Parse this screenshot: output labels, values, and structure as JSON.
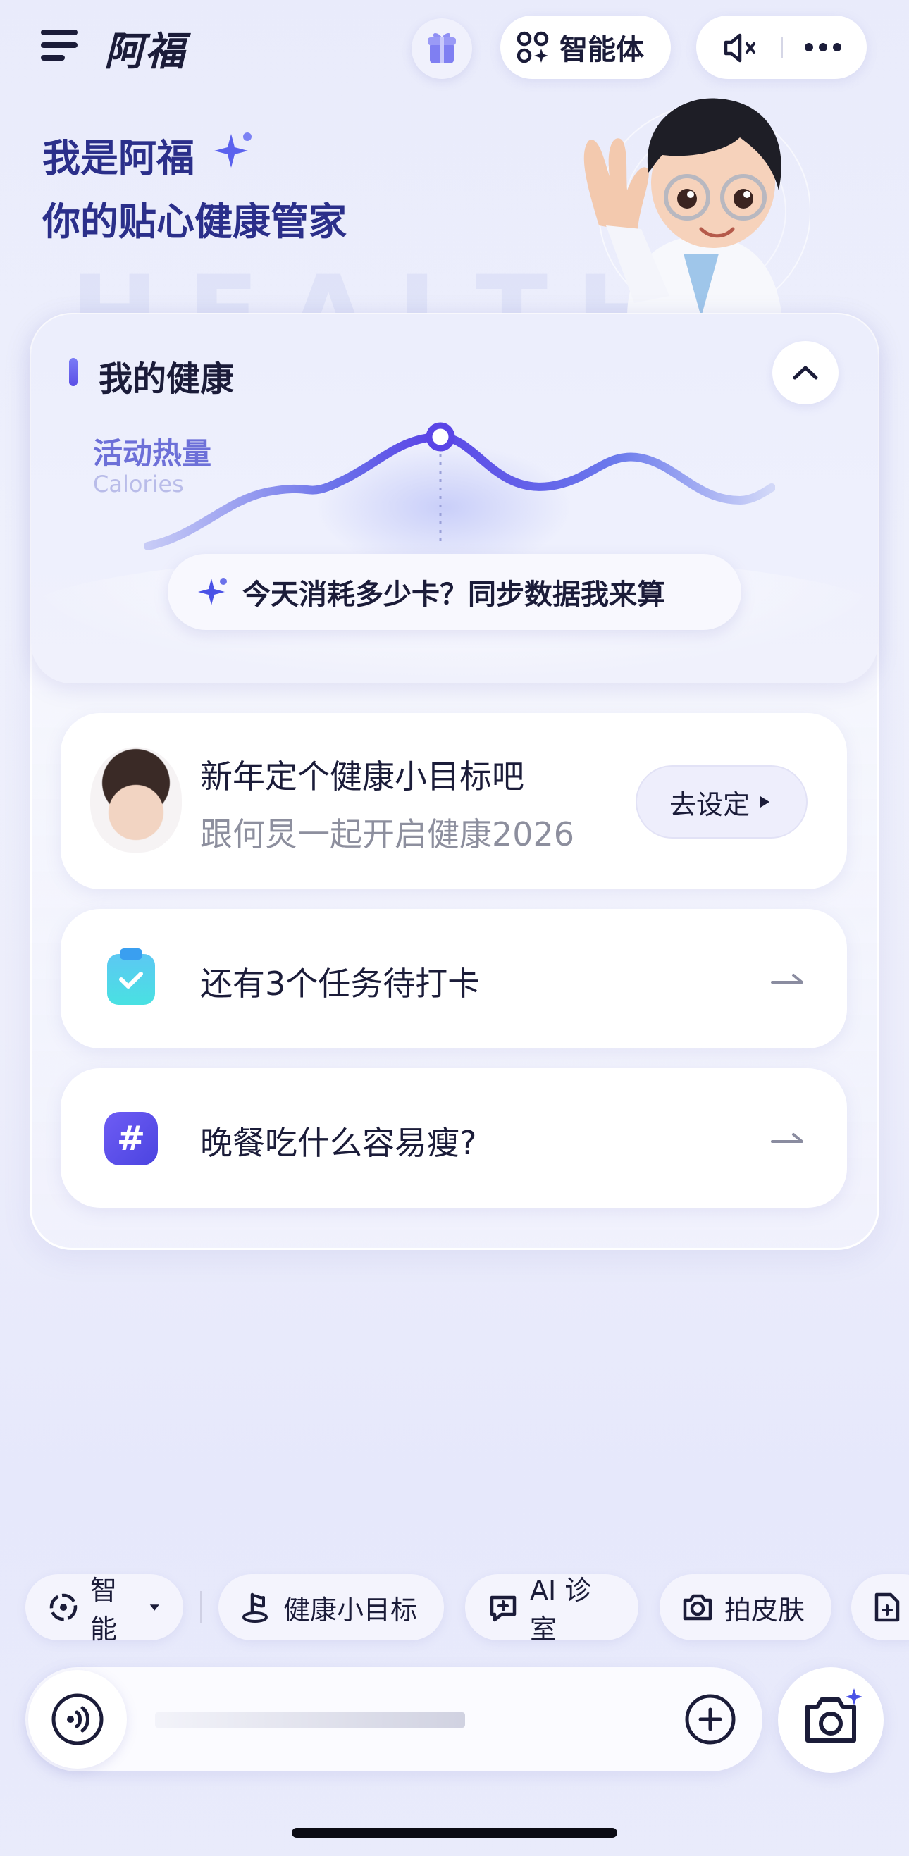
{
  "header": {
    "app_title": "阿福",
    "agent_label": "智能体",
    "icons": [
      "menu-icon",
      "gift-icon",
      "agent-grid-icon",
      "mute-icon",
      "more-icon"
    ]
  },
  "greeting": {
    "line1": "我是阿福",
    "line2": "你的贴心健康管家",
    "watermark": "HEALTH"
  },
  "health_card": {
    "title": "我的健康",
    "metric_label": "活动热量",
    "metric_sub": "Calories",
    "prompt": "今天消耗多少卡？同步数据我来算",
    "accent": "#5b4fe6"
  },
  "cards": {
    "goal": {
      "title": "新年定个健康小目标吧",
      "subtitle": "跟何炅一起开启健康2026",
      "button": "去设定"
    },
    "task": {
      "text": "还有3个任务待打卡"
    },
    "topic": {
      "text": "晚餐吃什么容易瘦?",
      "badge": "#"
    }
  },
  "chips": [
    {
      "label": "智能",
      "icon": "smart-mode-icon"
    },
    {
      "label": "健康小目标",
      "icon": "goal-icon"
    },
    {
      "label": "AI 诊室",
      "icon": "chat-plus-icon"
    },
    {
      "label": "拍皮肤",
      "icon": "camera-icon"
    }
  ],
  "input": {
    "placeholder": ""
  }
}
